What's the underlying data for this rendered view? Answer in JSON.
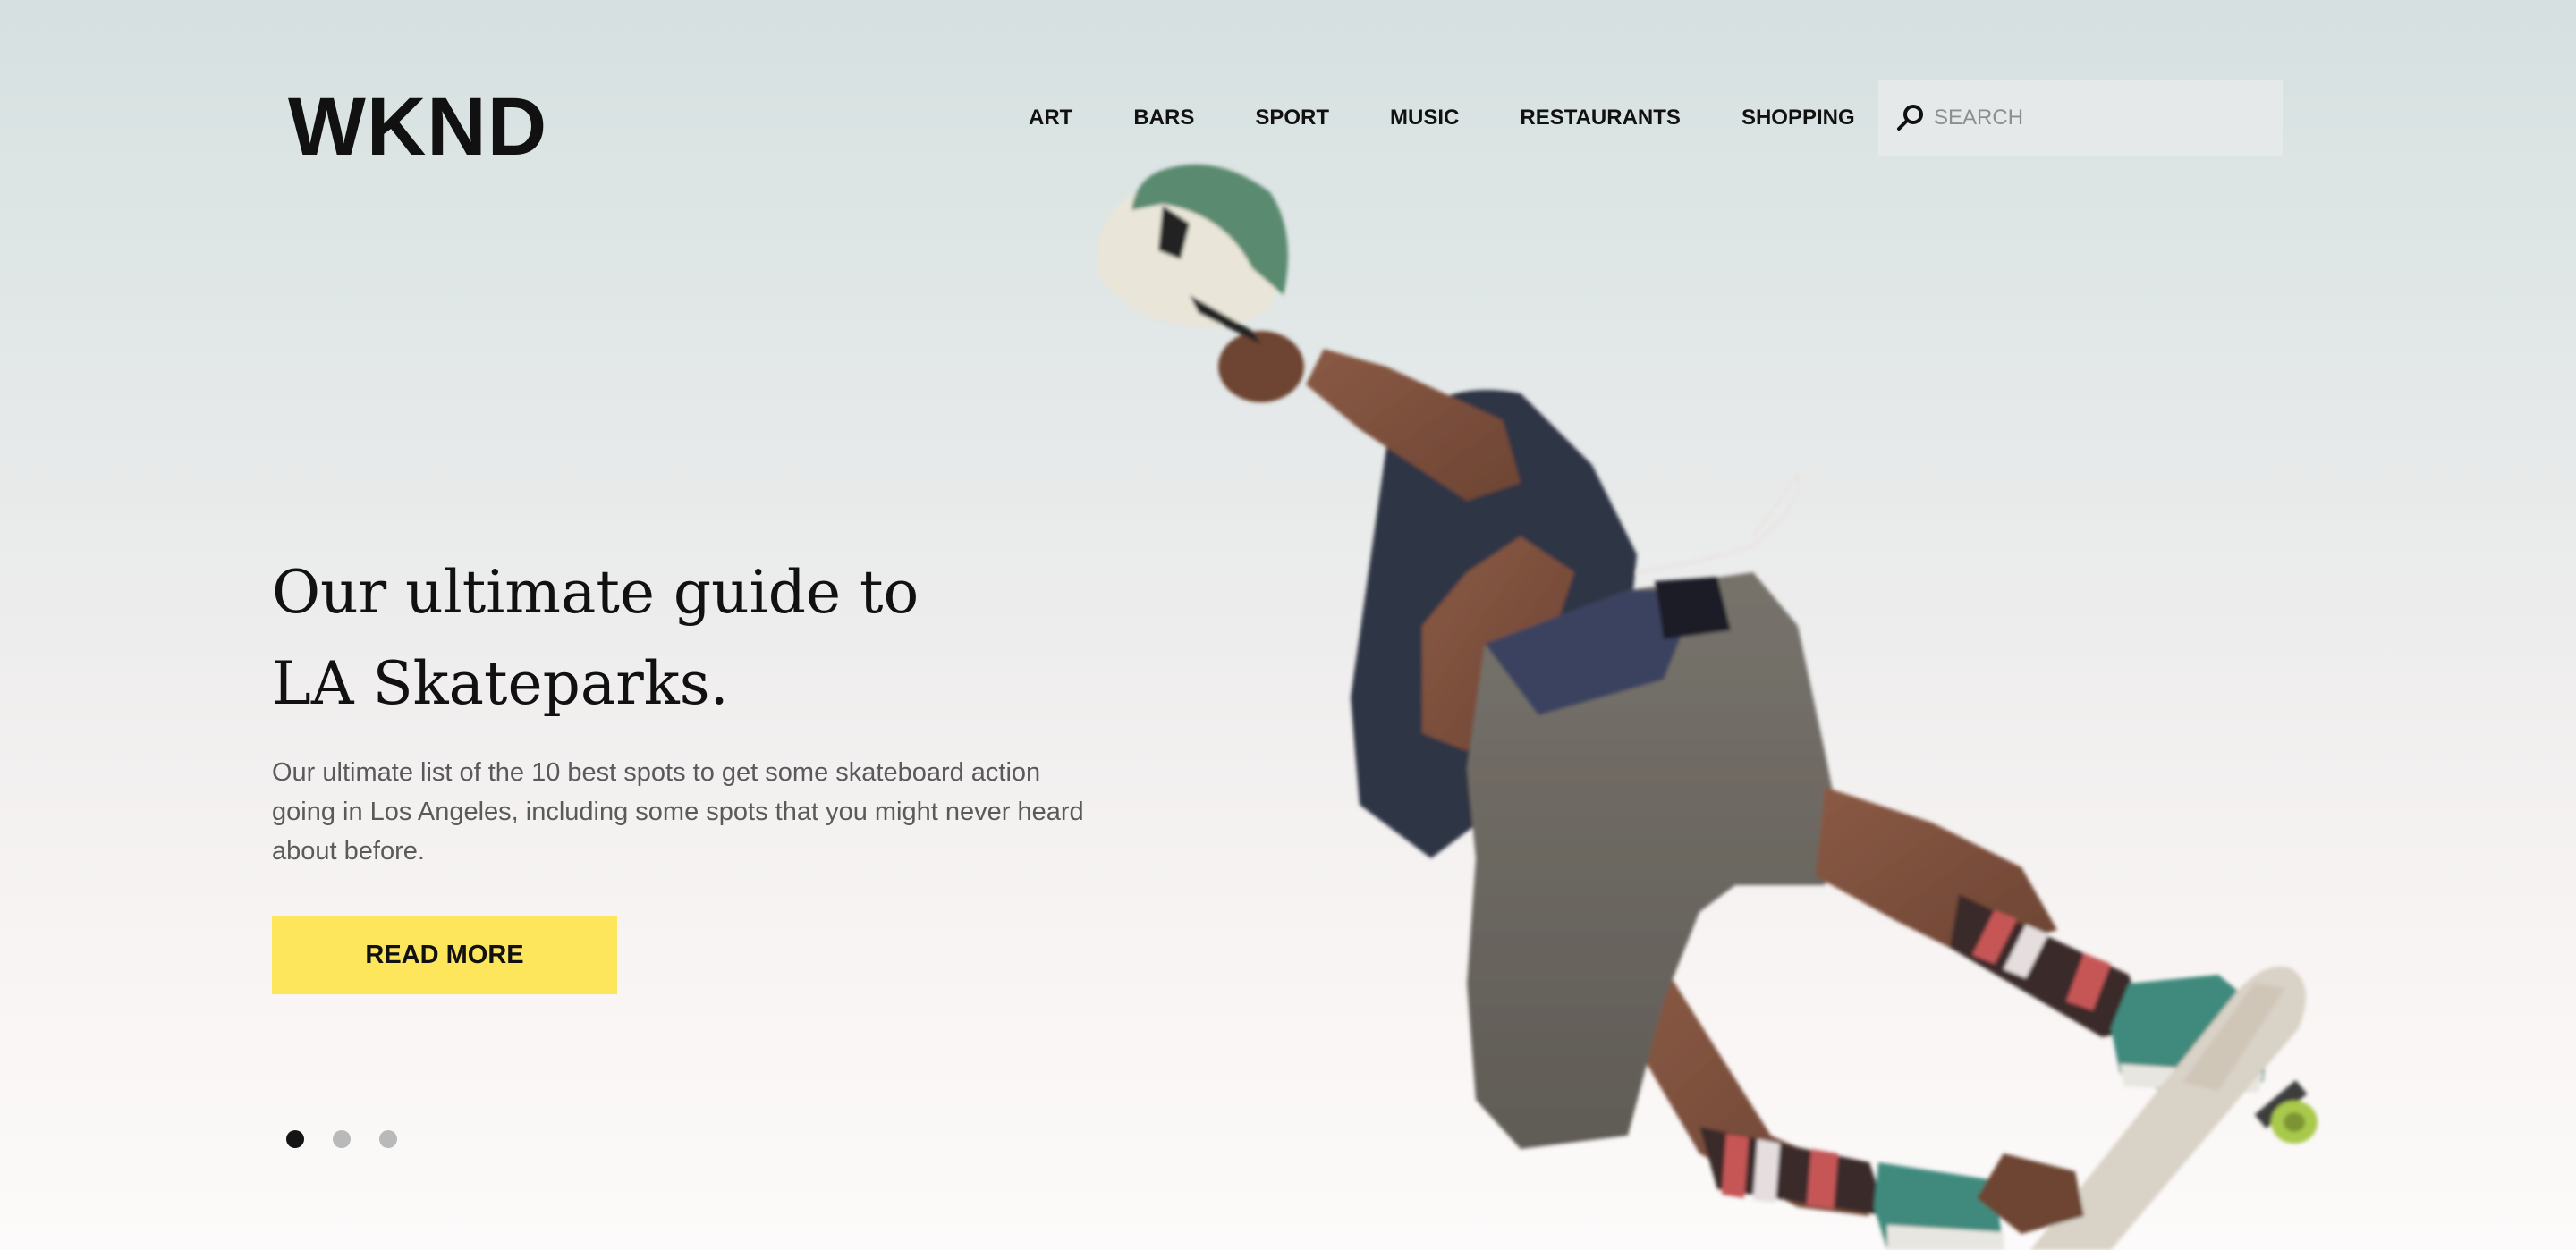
{
  "brand": {
    "logo_text": "WKND"
  },
  "nav": {
    "items": [
      {
        "label": "ART"
      },
      {
        "label": "BARS"
      },
      {
        "label": "SPORT"
      },
      {
        "label": "MUSIC"
      },
      {
        "label": "RESTAURANTS"
      },
      {
        "label": "SHOPPING"
      }
    ]
  },
  "search": {
    "placeholder": "SEARCH",
    "value": "",
    "icon": "search-icon"
  },
  "hero": {
    "title_line1": "Our ultimate guide to",
    "title_line2": "LA Skateparks.",
    "description": "Our ultimate list of the 10 best spots to get some skateboard action going in Los Angeles, including some spots that you might never heard about before.",
    "cta_label": "READ MORE",
    "image_subject": "skateboarder-photo",
    "carousel": {
      "total_slides": 3,
      "active_slide": 1
    }
  },
  "colors": {
    "cta_background": "#fde65c",
    "dot_active": "#141414",
    "dot_inactive": "#b9b9b9",
    "search_background": "#e6e9e9"
  }
}
